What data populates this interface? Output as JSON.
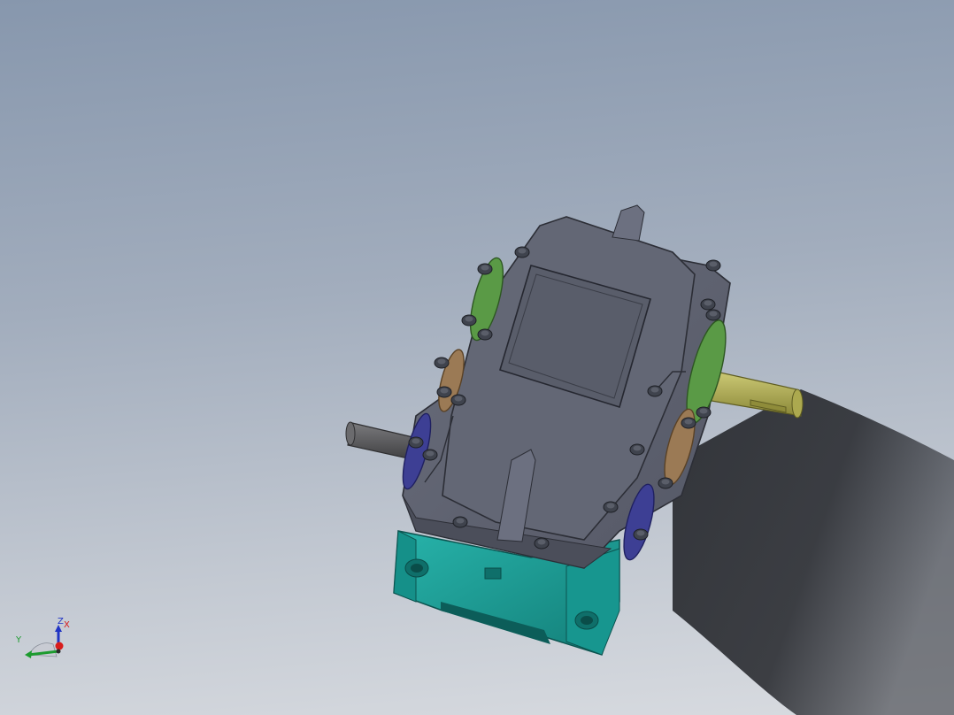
{
  "viewport": {
    "background_top": "#8797ad",
    "background_bottom": "#d8dbe0"
  },
  "model": {
    "icon": "gear-reducer-icon",
    "colors": {
      "housing_cover": "#5e6270",
      "housing_base": "#1fa39b",
      "bearing_cap_small": "#3d3f94",
      "bearing_cap_mid": "#9b7a55",
      "bearing_cap_large": "#5a9a46",
      "output_shaft": "#b7b45a",
      "input_shaft": "#5a5a5c",
      "bolts": "#3f434d",
      "shadow": "#303236"
    }
  },
  "triad": {
    "x_label": "X",
    "y_label": "Y",
    "z_label": "Z",
    "x_color": "#d81c1c",
    "y_color": "#1d9b2f",
    "z_color": "#2034c4"
  }
}
